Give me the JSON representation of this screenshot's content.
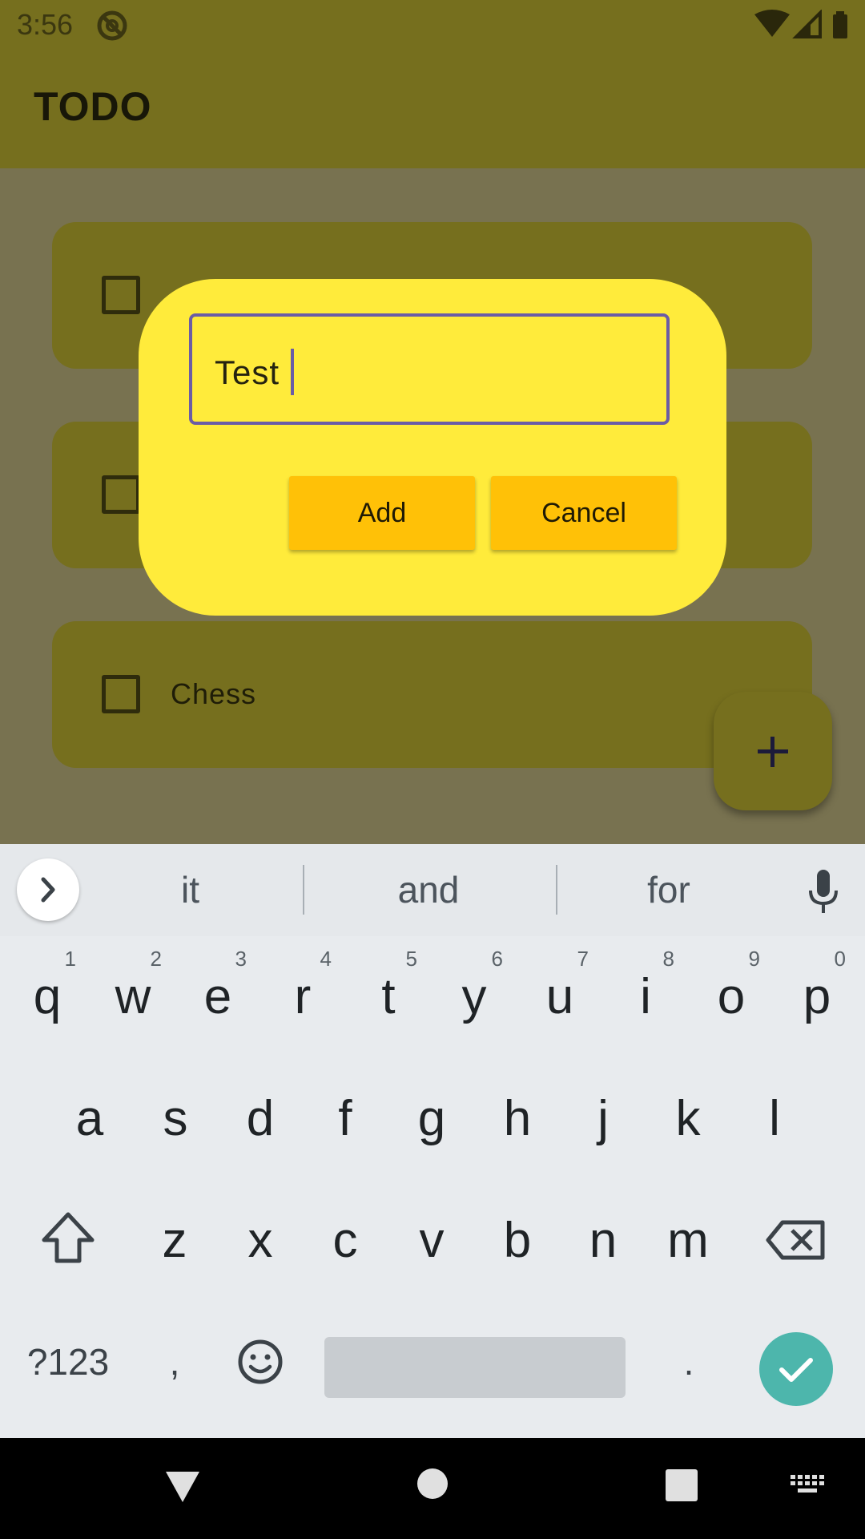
{
  "status_bar": {
    "time": "3:56"
  },
  "app_bar": {
    "title": "TODO"
  },
  "tasks": [
    {
      "label": ""
    },
    {
      "label": ""
    },
    {
      "label": "Chess"
    }
  ],
  "dialog": {
    "input_value": "Test",
    "add_label": "Add",
    "cancel_label": "Cancel"
  },
  "fab": {
    "icon": "plus-icon"
  },
  "keyboard": {
    "suggestions": [
      "it",
      "and",
      "for"
    ],
    "row1": [
      {
        "char": "q",
        "num": "1"
      },
      {
        "char": "w",
        "num": "2"
      },
      {
        "char": "e",
        "num": "3"
      },
      {
        "char": "r",
        "num": "4"
      },
      {
        "char": "t",
        "num": "5"
      },
      {
        "char": "y",
        "num": "6"
      },
      {
        "char": "u",
        "num": "7"
      },
      {
        "char": "i",
        "num": "8"
      },
      {
        "char": "o",
        "num": "9"
      },
      {
        "char": "p",
        "num": "0"
      }
    ],
    "row2": [
      "a",
      "s",
      "d",
      "f",
      "g",
      "h",
      "j",
      "k",
      "l"
    ],
    "row3": [
      "z",
      "x",
      "c",
      "v",
      "b",
      "n",
      "m"
    ],
    "symbols_label": "?123",
    "comma_label": ",",
    "period_label": "."
  },
  "colors": {
    "dialog_background": "#ffeb3b",
    "button_background": "#ffc107",
    "text_field_border": "#6b5ca5",
    "enter_key": "#4db6ac",
    "scrim_app_bar": "#766f1e"
  }
}
